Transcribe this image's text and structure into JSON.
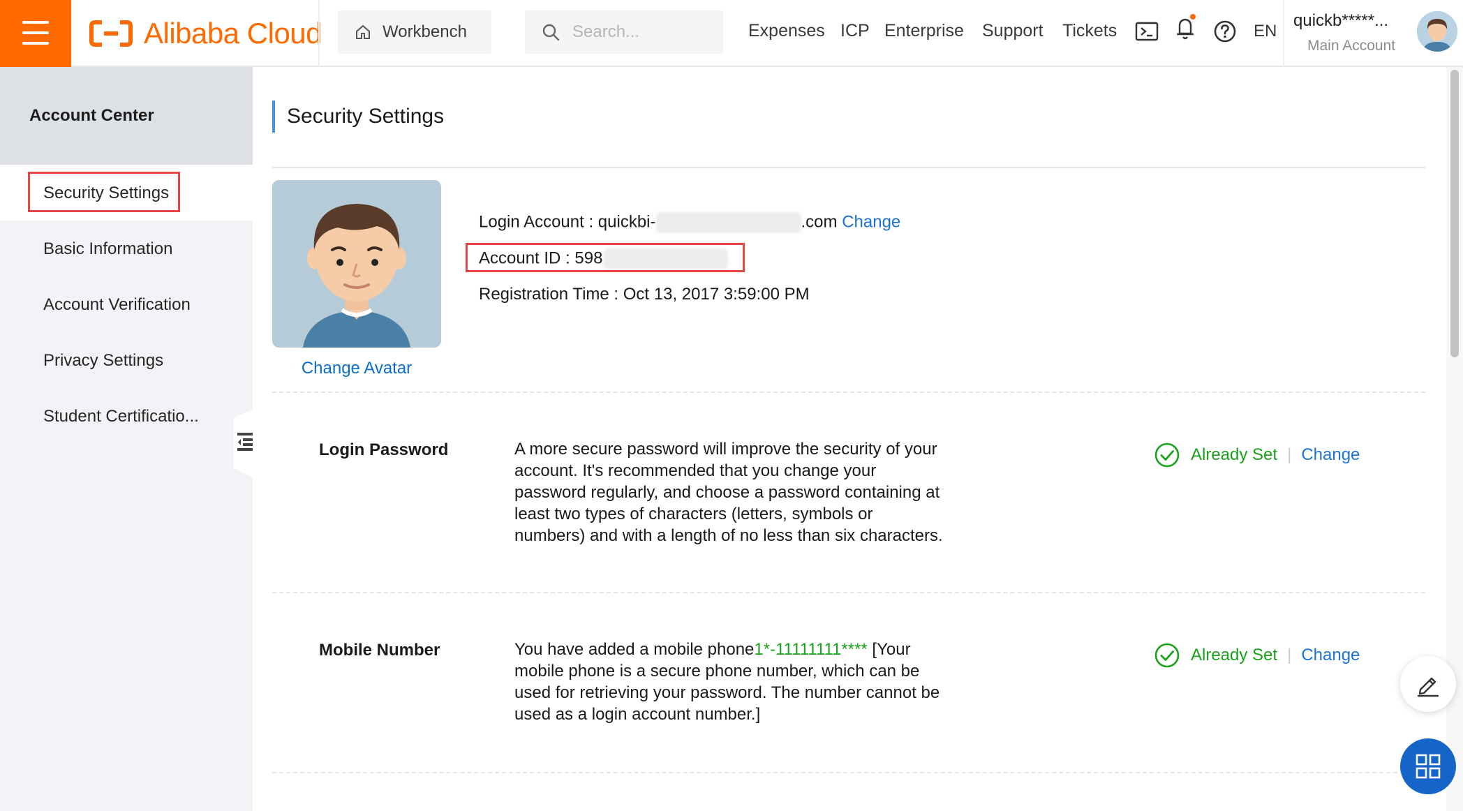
{
  "header": {
    "logo_text": "Alibaba Cloud",
    "workbench_label": "Workbench",
    "search_placeholder": "Search...",
    "nav_links": [
      "Expenses",
      "ICP",
      "Enterprise",
      "Support",
      "Tickets"
    ],
    "language": "EN",
    "user_name": "quickb*****...",
    "user_role": "Main Account",
    "brand_color": "#ff6a00"
  },
  "sidebar": {
    "title": "Account Center",
    "items": [
      {
        "label": "Security Settings",
        "active": true
      },
      {
        "label": "Basic Information"
      },
      {
        "label": "Account Verification"
      },
      {
        "label": "Privacy Settings"
      },
      {
        "label": "Student Certificatio..."
      }
    ]
  },
  "main": {
    "title": "Security Settings",
    "change_avatar": "Change Avatar",
    "login_account_label": "Login Account : quickbi-",
    "login_account_suffix": ".com",
    "login_account_change": "Change",
    "account_id_label": "Account ID : 598",
    "registration_time": "Registration Time : Oct 13, 2017 3:59:00 PM",
    "rows": [
      {
        "label": "Login Password",
        "description": "A more secure password will improve the security of your account. It's recommended that you change your password regularly, and choose a password containing at least two types of characters (letters, symbols or numbers) and with a length of no less than six characters.",
        "status": "Already Set",
        "action": "Change"
      },
      {
        "label": "Mobile Number",
        "description_prefix": "You have added a mobile phone",
        "phone": "1*-11111111****",
        "description_suffix": " [Your mobile phone is a secure phone number, which can be used for retrieving your password. The number cannot be used as a login account number.]",
        "status": "Already Set",
        "action": "Change"
      }
    ]
  },
  "colors": {
    "link": "#1a73d6",
    "success": "#1aa11a",
    "highlight_box": "#e84545",
    "accent_bar": "#4a90d9"
  },
  "icons": [
    "menu-icon",
    "home-icon",
    "search-icon",
    "terminal-icon",
    "bell-icon",
    "help-icon",
    "check-circle-icon",
    "sidebar-collapse-icon",
    "edit-icon",
    "grid-icon"
  ]
}
